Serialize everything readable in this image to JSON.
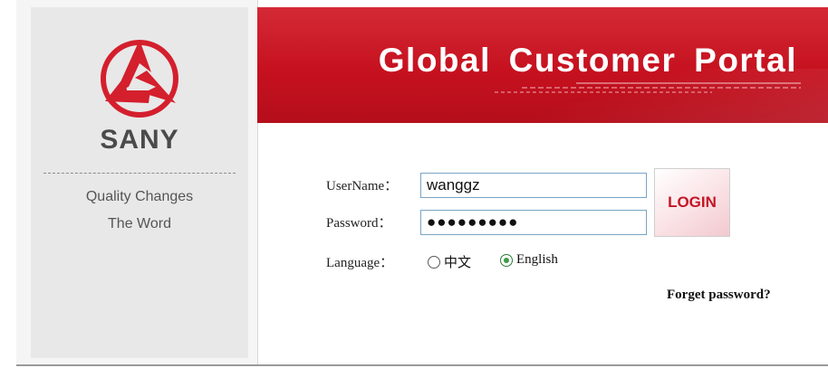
{
  "brand": {
    "name": "SANY",
    "slogan_line1": "Quality Changes",
    "slogan_line2": "The Word",
    "logo_icon": "sany-triangle-logo"
  },
  "header": {
    "title": "Global  Customer  Portal"
  },
  "form": {
    "username_label": "UserName：",
    "username_value": "wanggz",
    "password_label": "Password：",
    "password_mask": "●●●●●●●●●",
    "language_label": "Language：",
    "language_options": [
      {
        "label": "中文",
        "selected": false
      },
      {
        "label": "English",
        "selected": true
      }
    ],
    "login_label": "LOGIN",
    "forgot_link": "Forget password?"
  },
  "colors": {
    "brand_red": "#c6111f",
    "panel_gray": "#e8e8e8"
  }
}
